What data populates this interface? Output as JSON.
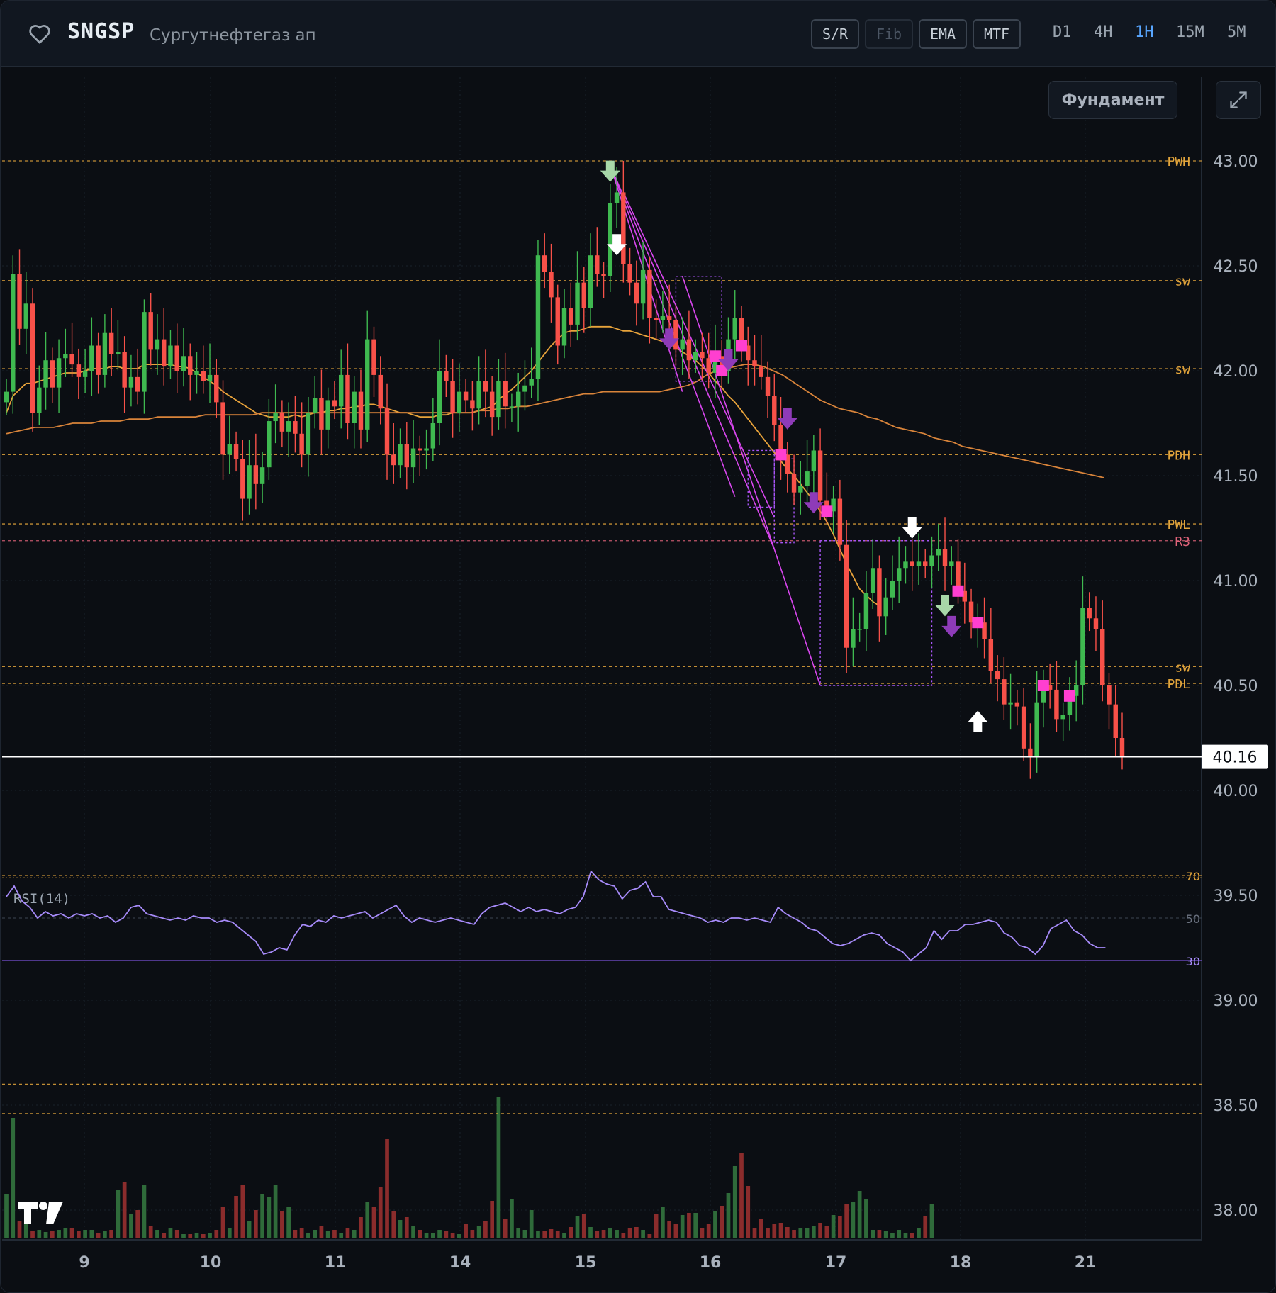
{
  "header": {
    "ticker": "SNGSP",
    "company": "Сургутнефтегаз ап",
    "tools": [
      {
        "label": "S/R",
        "enabled": true
      },
      {
        "label": "Fib",
        "enabled": false
      },
      {
        "label": "EMA",
        "enabled": true
      },
      {
        "label": "MTF",
        "enabled": true
      }
    ],
    "timeframes": [
      {
        "label": "D1",
        "active": false
      },
      {
        "label": "4H",
        "active": false
      },
      {
        "label": "1H",
        "active": true
      },
      {
        "label": "15M",
        "active": false
      },
      {
        "label": "5M",
        "active": false
      }
    ],
    "favorite_icon": "heart-icon"
  },
  "fundament_label": "Фундамент",
  "expand_icon": "expand-icon",
  "colors": {
    "up": "#3fb950",
    "down": "#f85149",
    "level": "#e3a53b",
    "r3": "#e0637a",
    "signal": "#d946ef",
    "box": "#a855f7",
    "ema_fast": "#e8a33b",
    "ema_slow": "#d9843a",
    "rsi": "#a78bfa",
    "price_line": "#ffffff"
  },
  "chart_data": {
    "type": "candlestick",
    "symbol": "SNGSP",
    "timeframe": "1H",
    "y_ticks": [
      "43.00",
      "42.50",
      "42.00",
      "41.50",
      "41.00",
      "40.50",
      "40.00",
      "39.50",
      "39.00",
      "38.50",
      "38.00"
    ],
    "x_ticks": [
      "9",
      "10",
      "11",
      "14",
      "15",
      "16",
      "17",
      "18",
      "21"
    ],
    "ylim": [
      37.85,
      43.35
    ],
    "last_price": "40.16",
    "levels": [
      {
        "label": "PWH",
        "price": 43.0
      },
      {
        "label": "sw",
        "price": 42.43
      },
      {
        "label": "sw",
        "price": 42.01
      },
      {
        "label": "PDH",
        "price": 41.6
      },
      {
        "label": "PWL",
        "price": 41.27
      },
      {
        "label": "R3",
        "price": 41.19
      },
      {
        "label": "sw",
        "price": 40.59
      },
      {
        "label": "PDL",
        "price": 40.51
      },
      {
        "label": "",
        "price": 38.6
      },
      {
        "label": "",
        "price": 38.46
      }
    ],
    "close": [
      41.9,
      42.46,
      42.2,
      42.32,
      41.8,
      41.92,
      42.05,
      41.92,
      42.06,
      42.08,
      42.03,
      41.97,
      42.0,
      42.12,
      41.98,
      42.18,
      42.08,
      42.09,
      41.92,
      41.97,
      41.9,
      42.28,
      42.1,
      42.15,
      42.02,
      42.12,
      42.0,
      42.07,
      41.98,
      42.0,
      41.95,
      41.98,
      41.85,
      41.6,
      41.65,
      41.58,
      41.39,
      41.55,
      41.46,
      41.54,
      41.76,
      41.8,
      41.71,
      41.76,
      41.7,
      41.6,
      41.8,
      41.87,
      41.72,
      41.86,
      41.83,
      41.98,
      41.75,
      41.9,
      41.72,
      42.15,
      41.98,
      41.82,
      41.6,
      41.55,
      41.65,
      41.54,
      41.63,
      41.62,
      41.63,
      41.75,
      42.0,
      41.95,
      41.8,
      41.9,
      41.86,
      41.82,
      41.95,
      41.9,
      41.78,
      41.95,
      41.83,
      41.83,
      41.9,
      41.93,
      41.96,
      42.55,
      42.47,
      42.35,
      42.12,
      42.3,
      42.22,
      42.42,
      42.3,
      42.55,
      42.46,
      42.45,
      42.8,
      42.85,
      42.51,
      42.42,
      42.32,
      42.48,
      42.25,
      42.24,
      42.26,
      42.24,
      42.1,
      42.15,
      42.05,
      42.09,
      42.06,
      41.99,
      42.07,
      42.0,
      42.15,
      42.25,
      42.12,
      42.05,
      42.02,
      41.97,
      41.88,
      41.74,
      41.6,
      41.51,
      41.42,
      41.45,
      41.52,
      41.62,
      41.38,
      41.33,
      41.39,
      41.17,
      40.68,
      40.77,
      40.77,
      40.94,
      41.06,
      40.83,
      40.92,
      41.0,
      41.06,
      41.09,
      41.07,
      41.09,
      41.07,
      41.12,
      41.15,
      41.07,
      41.09,
      40.95,
      40.9,
      40.8,
      40.8,
      40.72,
      40.57,
      40.53,
      40.41,
      40.42,
      40.4,
      40.2,
      40.16,
      40.42,
      40.5,
      40.48,
      40.34,
      40.36,
      40.45,
      40.5,
      40.87,
      40.82,
      40.77,
      40.5,
      40.41,
      40.25,
      40.16
    ],
    "ema_fast": [
      41.8,
      41.88,
      41.91,
      41.94,
      41.94,
      41.95,
      41.96,
      41.97,
      41.98,
      41.99,
      41.99,
      41.99,
      42.0,
      42.01,
      42.01,
      42.01,
      42.02,
      42.02,
      42.01,
      42.01,
      42.01,
      42.03,
      42.03,
      42.03,
      42.03,
      42.03,
      42.02,
      42.02,
      42.01,
      41.99,
      41.97,
      41.95,
      41.93,
      41.9,
      41.88,
      41.86,
      41.84,
      41.82,
      41.8,
      41.79,
      41.78,
      41.78,
      41.78,
      41.78,
      41.79,
      41.78,
      41.79,
      41.8,
      41.8,
      41.81,
      41.81,
      41.82,
      41.82,
      41.83,
      41.83,
      41.84,
      41.84,
      41.83,
      41.82,
      41.81,
      41.8,
      41.8,
      41.79,
      41.78,
      41.78,
      41.78,
      41.79,
      41.79,
      41.8,
      41.8,
      41.8,
      41.8,
      41.81,
      41.82,
      41.83,
      41.86,
      41.89,
      41.91,
      41.94,
      41.97,
      42.0,
      42.04,
      42.08,
      42.12,
      42.15,
      42.18,
      42.19,
      42.19,
      42.2,
      42.21,
      42.21,
      42.21,
      42.21,
      42.2,
      42.19,
      42.19,
      42.18,
      42.17,
      42.16,
      42.15,
      42.14,
      42.13,
      42.11,
      42.09,
      42.07,
      42.05,
      42.02,
      41.99,
      41.95,
      41.92,
      41.88,
      41.85,
      41.81,
      41.77,
      41.73,
      41.69,
      41.65,
      41.61,
      41.57,
      41.53,
      41.5,
      41.46,
      41.42,
      41.38,
      41.33,
      41.28,
      41.22,
      41.15,
      41.08,
      41.02,
      40.96,
      40.93,
      40.9,
      40.88
    ],
    "ema_slow": [
      41.7,
      41.71,
      41.72,
      41.73,
      41.73,
      41.73,
      41.74,
      41.75,
      41.75,
      41.75,
      41.76,
      41.76,
      41.76,
      41.77,
      41.77,
      41.77,
      41.78,
      41.78,
      41.78,
      41.78,
      41.78,
      41.79,
      41.79,
      41.79,
      41.79,
      41.79,
      41.79,
      41.8,
      41.8,
      41.8,
      41.8,
      41.8,
      41.8,
      41.8,
      41.8,
      41.8,
      41.8,
      41.8,
      41.8,
      41.8,
      41.8,
      41.8,
      41.8,
      41.8,
      41.8,
      41.8,
      41.8,
      41.8,
      41.8,
      41.8,
      41.81,
      41.81,
      41.82,
      41.82,
      41.83,
      41.83,
      41.84,
      41.85,
      41.86,
      41.87,
      41.88,
      41.89,
      41.89,
      41.9,
      41.9,
      41.9,
      41.9,
      41.9,
      41.9,
      41.9,
      41.91,
      41.92,
      41.93,
      41.95,
      41.98,
      42.0,
      42.01,
      42.02,
      42.03,
      42.03,
      42.02,
      42.0,
      41.98,
      41.95,
      41.92,
      41.89,
      41.86,
      41.84,
      41.82,
      41.81,
      41.8,
      41.78,
      41.77,
      41.75,
      41.73,
      41.72,
      41.71,
      41.7,
      41.68,
      41.67,
      41.66,
      41.64,
      41.63,
      41.62,
      41.61,
      41.6,
      41.59,
      41.58,
      41.57,
      41.56,
      41.55,
      41.54,
      41.53,
      41.52,
      41.51,
      41.5,
      41.49
    ],
    "rsi_levels": [
      70,
      50,
      30
    ],
    "rsi_label": "RSI(14)",
    "rsi_ticks": [
      "70",
      "50",
      "30"
    ],
    "rsi": [
      60,
      65,
      58,
      55,
      50,
      53,
      51,
      52,
      50,
      52,
      51,
      52,
      50,
      51,
      48,
      50,
      55,
      56,
      52,
      51,
      50,
      49,
      50,
      49,
      51,
      50,
      50,
      48,
      49,
      48,
      45,
      42,
      39,
      33,
      34,
      36,
      35,
      42,
      47,
      46,
      49,
      48,
      51,
      50,
      51,
      52,
      53,
      50,
      52,
      54,
      56,
      51,
      48,
      50,
      49,
      48,
      49,
      50,
      49,
      48,
      47,
      52,
      55,
      56,
      57,
      55,
      53,
      55,
      53,
      54,
      53,
      52,
      54,
      55,
      60,
      72,
      68,
      66,
      65,
      59,
      63,
      64,
      67,
      60,
      60,
      54,
      53,
      52,
      51,
      50,
      48,
      49,
      48,
      50,
      50,
      49,
      50,
      49,
      48,
      55,
      52,
      50,
      48,
      45,
      44,
      41,
      38,
      37,
      38,
      40,
      42,
      43,
      42,
      38,
      36,
      34,
      30,
      33,
      36,
      44,
      40,
      44,
      44,
      47,
      47,
      48,
      49,
      48,
      43,
      41,
      37,
      36,
      33,
      37,
      45,
      47,
      49,
      44,
      42,
      38,
      36,
      36
    ],
    "volume": [
      62,
      170,
      25,
      48,
      10,
      12,
      9,
      10,
      12,
      14,
      15,
      10,
      12,
      12,
      8,
      11,
      12,
      68,
      80,
      34,
      40,
      76,
      17,
      12,
      8,
      15,
      12,
      6,
      6,
      8,
      6,
      8,
      12,
      45,
      15,
      60,
      76,
      25,
      40,
      62,
      58,
      75,
      38,
      45,
      12,
      15,
      8,
      12,
      18,
      10,
      12,
      8,
      15,
      12,
      30,
      52,
      44,
      73,
      140,
      38,
      26,
      30,
      18,
      12,
      8,
      8,
      12,
      10,
      8,
      6,
      20,
      12,
      18,
      24,
      53,
      200,
      28,
      55,
      14,
      12,
      40,
      10,
      10,
      13,
      10,
      7,
      16,
      32,
      34,
      16,
      10,
      12,
      14,
      12,
      8,
      14,
      16,
      12,
      6,
      34,
      44,
      24,
      20,
      33,
      36,
      36,
      15,
      20,
      38,
      46,
      64,
      102,
      120,
      74,
      14,
      28,
      14,
      20,
      22,
      16,
      12,
      14,
      14,
      17,
      22,
      18,
      33,
      32,
      48,
      52,
      67,
      56,
      12,
      12,
      10,
      8,
      12,
      8,
      8,
      15,
      32,
      48
    ]
  }
}
